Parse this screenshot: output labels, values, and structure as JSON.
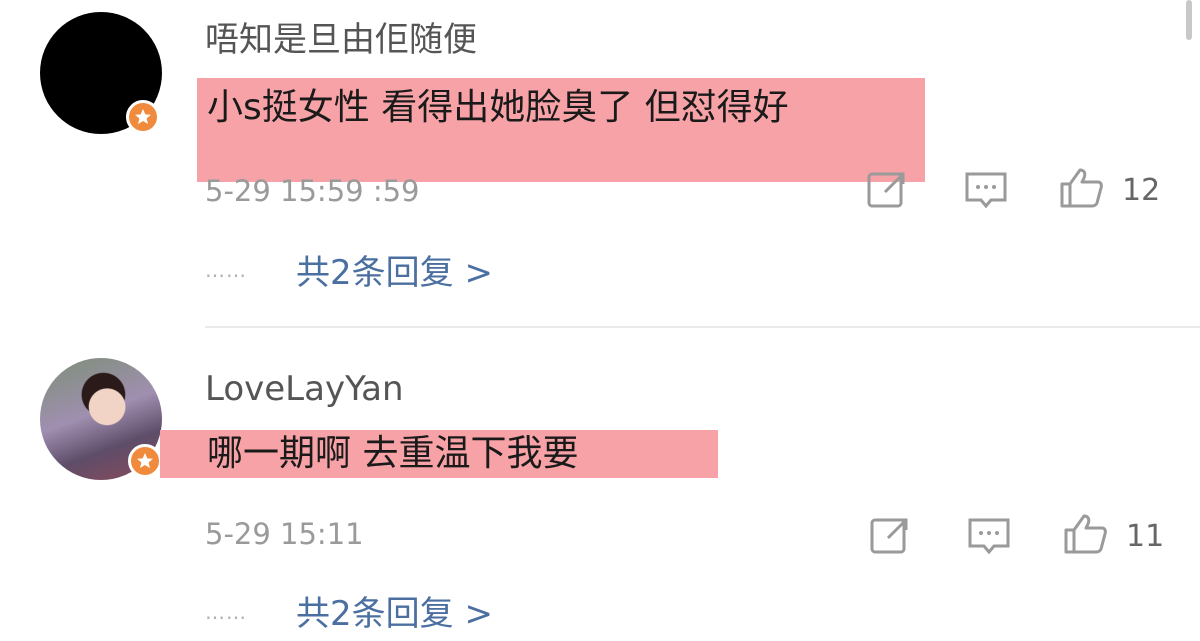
{
  "comments": [
    {
      "username": "唔知是旦由佢随便",
      "avatar": "black-avatar",
      "badge_icon": "star-badge-icon",
      "text": "小s挺女性 看得出她脸臭了 但怼得好",
      "timestamp": "5-29 15:59 :59",
      "actions": {
        "share_icon": "share-icon",
        "comment_icon": "comment-icon",
        "like_icon": "thumbs-up-icon",
        "like_count": "12"
      },
      "ellipsis": "……",
      "replies_label": "共2条回复 >"
    },
    {
      "username": "LoveLayYan",
      "avatar": "photo-avatar",
      "badge_icon": "star-badge-icon",
      "text": "哪一期啊 去重温下我要",
      "timestamp": "5-29 15:11",
      "actions": {
        "share_icon": "share-icon",
        "comment_icon": "comment-icon",
        "like_icon": "thumbs-up-icon",
        "like_count": "11"
      },
      "ellipsis": "……",
      "replies_label": "共2条回复 >"
    }
  ],
  "colors": {
    "highlight": "#f6a2a6",
    "reply_link": "#4a6fa0",
    "badge": "#f08a3c"
  }
}
